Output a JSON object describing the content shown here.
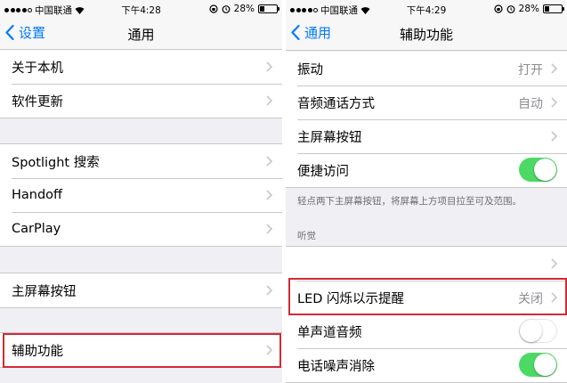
{
  "left": {
    "status": {
      "carrier": "中国联通",
      "time": "下午4:28",
      "battery": "28%",
      "battery_level": 0.28
    },
    "nav": {
      "back_label": "设置",
      "title": "通用"
    },
    "groups": [
      {
        "items": [
          {
            "label": "关于本机"
          },
          {
            "label": "软件更新"
          }
        ]
      },
      {
        "items": [
          {
            "label": "Spotlight 搜索"
          },
          {
            "label": "Handoff"
          },
          {
            "label": "CarPlay"
          }
        ]
      },
      {
        "items": [
          {
            "label": "主屏幕按钮"
          }
        ]
      },
      {
        "items": [
          {
            "label": "辅助功能"
          }
        ]
      }
    ]
  },
  "right": {
    "status": {
      "carrier": "中国联通",
      "time": "下午4:29",
      "battery": "28%",
      "battery_level": 0.28
    },
    "nav": {
      "back_label": "通用",
      "title": "辅助功能"
    },
    "group1": {
      "items": [
        {
          "label": "振动",
          "value": "打开"
        },
        {
          "label": "音频通话方式",
          "value": "自动"
        },
        {
          "label": "主屏幕按钮"
        },
        {
          "label": "便捷访问",
          "switch": "on"
        }
      ],
      "footnote": "轻点两下主屏幕按钮，将屏幕上方项目拉至可及范围。"
    },
    "section_header": "听觉",
    "group2": {
      "items": [
        {
          "label": ""
        },
        {
          "label": "LED 闪烁以示提醒",
          "value": "关闭"
        },
        {
          "label": "单声道音频",
          "switch": "off"
        },
        {
          "label": "电话噪声消除",
          "switch": "on"
        }
      ]
    }
  },
  "colors": {
    "accent": "#007aff",
    "switch_on": "#4cd964",
    "highlight": "#d12b36",
    "background": "#efeff4"
  }
}
